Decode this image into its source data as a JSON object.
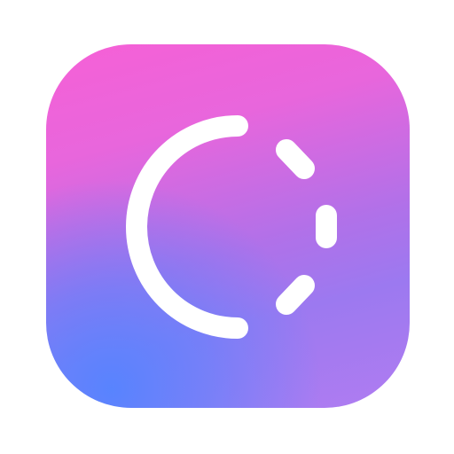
{
  "icon": {
    "name": "progress-loader-app-icon",
    "glyph": "partial-circle-with-dashed-arc",
    "colors": {
      "gradient_top": "#f660d6",
      "gradient_mid": "#b071e9",
      "gradient_bottom_left": "#5484ff",
      "gradient_bottom_right": "#b07cf1",
      "glyph": "#ffffff",
      "background": "#ffffff"
    }
  }
}
